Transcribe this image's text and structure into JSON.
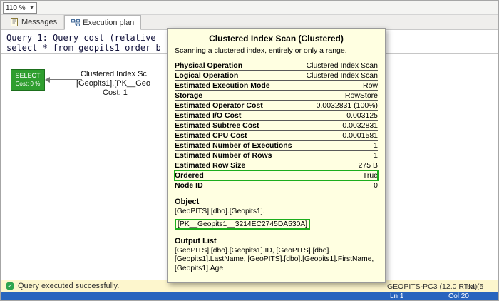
{
  "window": {
    "zoom": "110 %"
  },
  "tabs": {
    "messages": "Messages",
    "execution_plan": "Execution plan"
  },
  "query": {
    "line1": "Query 1: Query cost (relative",
    "line2": "select * from geopits1 order b"
  },
  "plan": {
    "select_node": {
      "title": "SELECT",
      "cost": "Cost: 0 %"
    },
    "scan_node": {
      "line1": "Clustered Index Sc",
      "line2": "[Geopits1].[PK__Geo",
      "line3": "Cost: 1"
    }
  },
  "tooltip": {
    "title": "Clustered Index Scan (Clustered)",
    "subtitle": "Scanning a clustered index, entirely or only a range.",
    "rows": [
      {
        "label": "Physical Operation",
        "value": "Clustered Index Scan"
      },
      {
        "label": "Logical Operation",
        "value": "Clustered Index Scan"
      },
      {
        "label": "Estimated Execution Mode",
        "value": "Row"
      },
      {
        "label": "Storage",
        "value": "RowStore"
      },
      {
        "label": "Estimated Operator Cost",
        "value": "0.0032831 (100%)"
      },
      {
        "label": "Estimated I/O Cost",
        "value": "0.003125"
      },
      {
        "label": "Estimated Subtree Cost",
        "value": "0.0032831"
      },
      {
        "label": "Estimated CPU Cost",
        "value": "0.0001581"
      },
      {
        "label": "Estimated Number of Executions",
        "value": "1"
      },
      {
        "label": "Estimated Number of Rows",
        "value": "1"
      },
      {
        "label": "Estimated Row Size",
        "value": "275 B"
      },
      {
        "label": "Ordered",
        "value": "True",
        "highlight": true
      },
      {
        "label": "Node ID",
        "value": "0"
      }
    ],
    "object_heading": "Object",
    "object_lines": [
      "[GeoPITS].[dbo].[Geopits1]."
    ],
    "object_highlight": "[PK__Geopits1__3214EC2745DA530A]",
    "output_heading": "Output List",
    "output_lines": [
      "[GeoPITS].[dbo].[Geopits1].ID, [GeoPITS].[dbo].",
      "[Geopits1].LastName, [GeoPITS].[dbo].[Geopits1].FirstName,",
      "[Geopits1].Age"
    ]
  },
  "statusbar": {
    "message": "Query executed successfully.",
    "server": "GEOPITS-PC3 (12.0 RTM)",
    "user": "sa (5"
  },
  "bottombar": {
    "line": "Ln 1",
    "column": "Col 20"
  },
  "colors": {
    "tooltip_bg": "#ffffe1",
    "highlight_green": "#1cad1c",
    "status_bg": "#fdf6cd",
    "bottombar_bg": "#2864be",
    "select_node_green": "#2f9e2f"
  }
}
